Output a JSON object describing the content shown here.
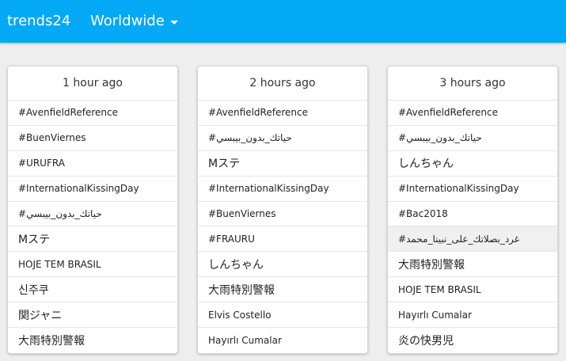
{
  "header": {
    "brand": "trends24",
    "region": "Worldwide"
  },
  "columns": [
    {
      "title": "1 hour ago",
      "items": [
        "#AvenfieldReference",
        "#BuenViernes",
        "#URUFRA",
        "#InternationalKissingDay",
        "#حياتك_بدون_بيبسي",
        "Mステ",
        "HOJE TEM BRASIL",
        "신주쿠",
        "関ジャニ",
        "大雨特別警報"
      ]
    },
    {
      "title": "2 hours ago",
      "items": [
        "#AvenfieldReference",
        "#حياتك_بدون_بيبسي",
        "Mステ",
        "#InternationalKissingDay",
        "#BuenViernes",
        "#FRAURU",
        "しんちゃん",
        "大雨特別警報",
        "Elvis Costello",
        "Hayırlı Cumalar"
      ]
    },
    {
      "title": "3 hours ago",
      "items": [
        "#AvenfieldReference",
        "#حياتك_بدون_بيبسي",
        "しんちゃん",
        "#InternationalKissingDay",
        "#Bac2018",
        "#غرد_بصلاتك_على_نبينا_محمد",
        "大雨特別警報",
        "HOJE TEM BRASIL",
        "Hayırlı Cumalar",
        "炎の快男児"
      ]
    }
  ]
}
